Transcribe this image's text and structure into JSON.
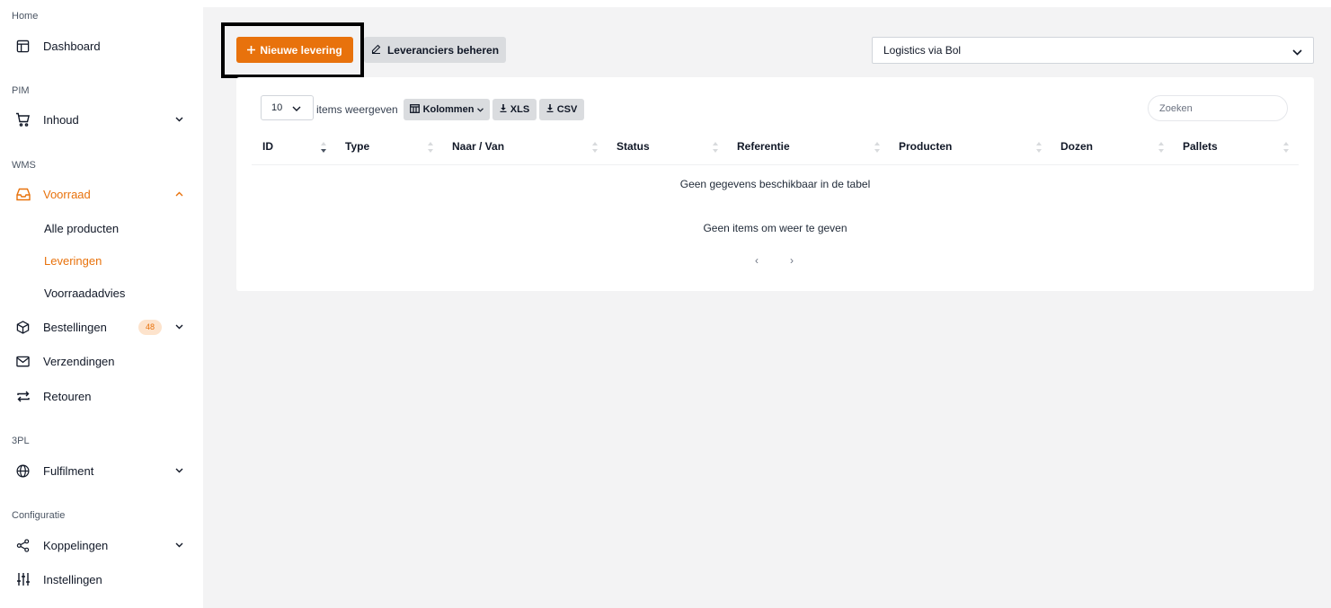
{
  "sidebar": {
    "sections": [
      {
        "label": "Home"
      },
      {
        "label": "PIM"
      },
      {
        "label": "WMS"
      },
      {
        "label": "3PL"
      },
      {
        "label": "Configuratie"
      }
    ],
    "items": {
      "dashboard": {
        "label": "Dashboard",
        "icon": "layout-icon"
      },
      "inhoud": {
        "label": "Inhoud",
        "icon": "cart-icon"
      },
      "voorraad": {
        "label": "Voorraad",
        "icon": "inbox-icon",
        "active": true
      },
      "bestellingen": {
        "label": "Bestellingen",
        "icon": "box-icon",
        "badge": "48"
      },
      "verzendingen": {
        "label": "Verzendingen",
        "icon": "mail-icon"
      },
      "retouren": {
        "label": "Retouren",
        "icon": "repeat-icon"
      },
      "fulfilment": {
        "label": "Fulfilment",
        "icon": "globe-icon"
      },
      "koppelingen": {
        "label": "Koppelingen",
        "icon": "share-icon"
      },
      "instellingen": {
        "label": "Instellingen",
        "icon": "sliders-icon"
      }
    },
    "subitems": {
      "alle_producten": "Alle producten",
      "leveringen": "Leveringen",
      "voorraadadvies": "Voorraadadvies"
    }
  },
  "toolbar": {
    "new_delivery": "Nieuwe levering",
    "manage_suppliers": "Leveranciers beheren",
    "channel_select": "Logistics via Bol"
  },
  "table": {
    "page_size": "10",
    "items_label": "items weergeven",
    "columns_btn": "Kolommen",
    "xls_btn": "XLS",
    "csv_btn": "CSV",
    "search_placeholder": "Zoeken",
    "headers": [
      "ID",
      "Type",
      "Naar / Van",
      "Status",
      "Referentie",
      "Producten",
      "Dozen",
      "Pallets"
    ],
    "empty_table": "Geen gegevens beschikbaar in de tabel",
    "empty_items": "Geen items om weer te geven",
    "prev": "‹",
    "next": "›"
  },
  "colors": {
    "accent": "#e8720c",
    "badge_bg": "#fde3cc",
    "button_gray": "#dadcdf",
    "main_bg": "#f3f3f4"
  }
}
